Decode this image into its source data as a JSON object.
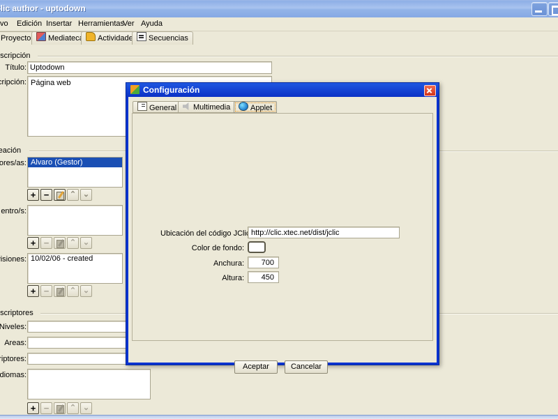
{
  "window": {
    "title": "Clic author - uptodown",
    "controls": {
      "minimize": "minimize-button",
      "maximize": "maximize-button"
    }
  },
  "menubar": [
    {
      "label": "vo"
    },
    {
      "label": "Edición"
    },
    {
      "label": "Insertar"
    },
    {
      "label": "Herramientas"
    },
    {
      "label": "Ver"
    },
    {
      "label": "Ayuda"
    }
  ],
  "tabs": [
    {
      "label": "Proyecto",
      "selected": true,
      "icon": ""
    },
    {
      "label": "Mediateca",
      "selected": false,
      "icon": "media-icon"
    },
    {
      "label": "Actividades",
      "selected": false,
      "icon": "activities-icon"
    },
    {
      "label": "Secuencias",
      "selected": false,
      "icon": "sequences-icon"
    }
  ],
  "project": {
    "section_description": "escripción",
    "section_creation": "reación",
    "section_descriptors": "escriptores",
    "fields": {
      "title_label": "Título:",
      "title_value": "Uptodown",
      "description_label": "scripción:",
      "description_value": "Página web",
      "authors_label": "ores/as:",
      "authors_value": "Alvaro (Gestor)",
      "centers_label": "entro/s:",
      "centers_value": "",
      "revisions_label": "visiones:",
      "revisions_value": "10/02/06 - created",
      "levels_label": "Niveles:",
      "levels_value": "",
      "areas_label": "Areas:",
      "areas_value": "",
      "descriptors_label": "criptores:",
      "descriptors_value": "",
      "languages_label": "Idiomas:",
      "languages_value": ""
    },
    "row_buttons": {
      "add": "+",
      "remove": "−",
      "edit": "edit-icon",
      "up": "⌃",
      "down": "⌄"
    }
  },
  "dialog": {
    "title": "Configuración",
    "icon": "jclic-logo-icon",
    "close_label": "close-icon",
    "tabs": [
      {
        "label": "General",
        "icon": "general-icon",
        "selected": false
      },
      {
        "label": "Multimedia",
        "icon": "speaker-icon",
        "selected": false
      },
      {
        "label": "Applet",
        "icon": "globe-icon",
        "selected": true
      }
    ],
    "applet": {
      "code_location_label": "Ubicación del código JClic:",
      "code_location_value": "http://clic.xtec.net/dist/jclic",
      "background_color_label": "Color de fondo:",
      "background_color_value": "#ffffff",
      "width_label": "Anchura:",
      "width_value": "700",
      "height_label": "Altura:",
      "height_value": "450"
    },
    "buttons": {
      "accept": "Aceptar",
      "cancel": "Cancelar"
    }
  }
}
